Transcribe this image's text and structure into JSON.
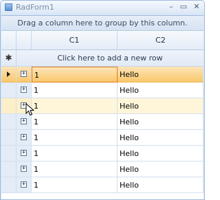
{
  "window": {
    "title": "RadForm1",
    "minimize": "–",
    "maximize": "▭",
    "close": "✕"
  },
  "grid": {
    "group_panel_text": "Drag a column here to group by this column.",
    "columns": [
      "C1",
      "C2"
    ],
    "new_row_text": "Click here to add a new row",
    "new_row_glyph": "✱",
    "rows": [
      {
        "c1": "1",
        "c2": "Hello"
      },
      {
        "c1": "1",
        "c2": "Hello"
      },
      {
        "c1": "1",
        "c2": "Hello"
      },
      {
        "c1": "1",
        "c2": "Hello"
      },
      {
        "c1": "1",
        "c2": "Hello"
      },
      {
        "c1": "1",
        "c2": "Hello"
      },
      {
        "c1": "1",
        "c2": "Hello"
      },
      {
        "c1": "1",
        "c2": "Hello"
      }
    ],
    "expander_glyph": "+",
    "current_row_index": 0,
    "hover_row_index": 2
  },
  "colors": {
    "current_row": "#f9c86b",
    "hover_row": "#fff6d9",
    "header": "#e3ecf7"
  }
}
